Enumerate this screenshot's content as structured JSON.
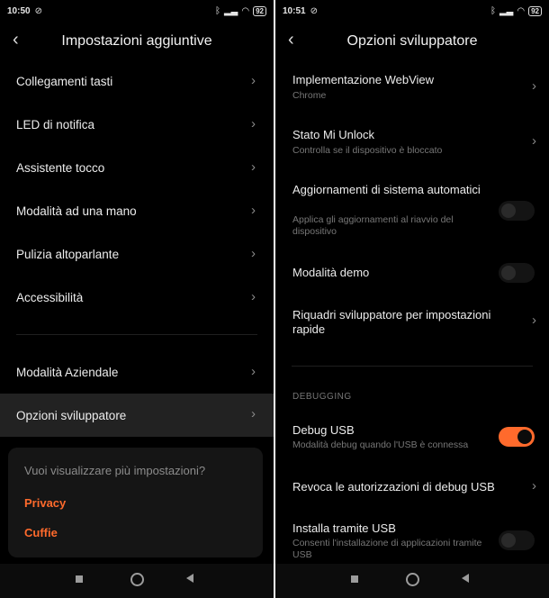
{
  "left_screen": {
    "status": {
      "time": "10:50",
      "battery": "92"
    },
    "title": "Impostazioni aggiuntive",
    "items": [
      {
        "label": "Collegamenti tasti"
      },
      {
        "label": "LED di notifica"
      },
      {
        "label": "Assistente tocco"
      },
      {
        "label": "Modalità ad una mano"
      },
      {
        "label": "Pulizia altoparlante"
      },
      {
        "label": "Accessibilità"
      },
      {
        "label": "Modalità Aziendale"
      },
      {
        "label": "Opzioni sviluppatore"
      }
    ],
    "card": {
      "question": "Vuoi visualizzare più impostazioni?",
      "links": [
        "Privacy",
        "Cuffie"
      ]
    }
  },
  "right_screen": {
    "status": {
      "time": "10:51",
      "battery": "92"
    },
    "title": "Opzioni sviluppatore",
    "items": [
      {
        "title": "Implementazione WebView",
        "subtitle": "Chrome"
      },
      {
        "title": "Stato Mi Unlock",
        "subtitle": "Controlla se il dispositivo è bloccato"
      },
      {
        "title": "Aggiornamenti di sistema automatici",
        "subtitle": "Applica gli aggiornamenti al riavvio del dispositivo"
      },
      {
        "title": "Modalità demo",
        "subtitle": ""
      },
      {
        "title": "Riquadri sviluppatore per impostazioni rapide",
        "subtitle": ""
      },
      {
        "title": "Debug USB",
        "subtitle": "Modalità debug quando l'USB è connessa"
      },
      {
        "title": "Revoca le autorizzazioni di debug USB",
        "subtitle": ""
      },
      {
        "title": "Installa tramite USB",
        "subtitle": "Consenti l'installazione di applicazioni tramite USB"
      }
    ],
    "section_label": "DEBUGGING",
    "toggles": {
      "auto_updates": false,
      "demo_mode": false,
      "debug_usb": true,
      "install_via_usb": false
    }
  },
  "colors": {
    "accent": "#ff6a2c",
    "background": "#000000",
    "active_row": "#222222"
  }
}
